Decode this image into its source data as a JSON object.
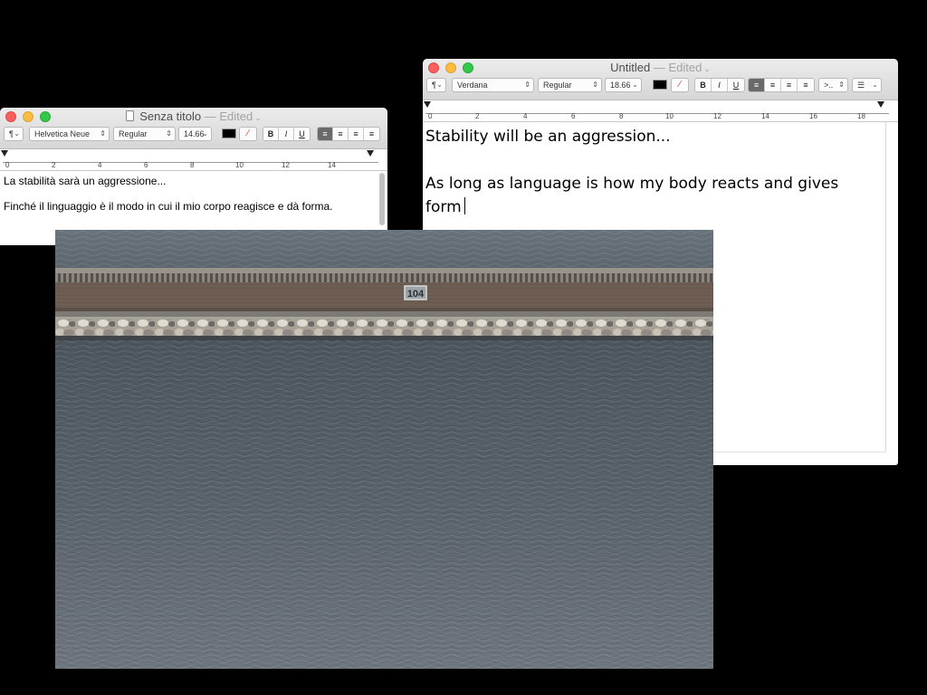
{
  "left_window": {
    "title": "Senza titolo",
    "edited_suffix": "— Edited",
    "toolbar": {
      "paragraph_style": "¶",
      "font_family": "Helvetica Neue",
      "font_style": "Regular",
      "font_size": "14.66",
      "bold": "B",
      "italic": "I",
      "underline": "U"
    },
    "ruler": [
      "0",
      "2",
      "4",
      "6",
      "8",
      "10",
      "12",
      "14"
    ],
    "lines": [
      "La stabilità sarà un aggressione...",
      "Finché il linguaggio è il modo in cui il mio corpo reagisce e dà forma."
    ]
  },
  "right_window": {
    "title": "Untitled",
    "edited_suffix": "— Edited",
    "toolbar": {
      "paragraph_style": "¶",
      "font_family": "Verdana",
      "font_style": "Regular",
      "font_size": "18.66",
      "bold": "B",
      "italic": "I",
      "underline": "U",
      "spacing": ">..",
      "list": "☰"
    },
    "ruler": [
      "0",
      "2",
      "4",
      "6",
      "8",
      "10",
      "12",
      "14",
      "16",
      "18"
    ],
    "lines": [
      "Stability will be an aggression...",
      "As long as language is how my body reacts and gives form"
    ]
  },
  "photo": {
    "sign_number": "104"
  },
  "colors": {
    "desktop": "#000000",
    "close": "#fc605c",
    "minimize": "#fdbc40",
    "zoom": "#34c84a",
    "sea": "#5b646c",
    "breakwater_wall": "#6d5d52"
  }
}
